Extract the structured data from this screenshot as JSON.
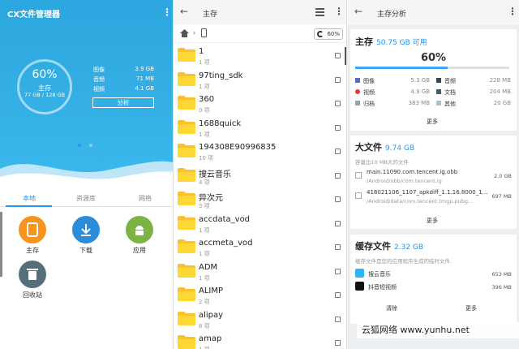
{
  "panel1": {
    "app_title": "CX文件管理器",
    "ring": {
      "percent": "60%",
      "label": "主存",
      "size": "77 GB / 128 GB"
    },
    "stats": [
      {
        "label": "图像",
        "value": "3.9 GB"
      },
      {
        "label": "音频",
        "value": "71 MB"
      },
      {
        "label": "视频",
        "value": "4.1 GB"
      }
    ],
    "analyze_label": "分析",
    "tabs": [
      "本地",
      "资源库",
      "网络"
    ],
    "categories": [
      {
        "label": "主存",
        "color": "#f7941d"
      },
      {
        "label": "下载",
        "color": "#2b8dd8"
      },
      {
        "label": "应用",
        "color": "#7cb342"
      },
      {
        "label": "回收站",
        "color": "#546e7a"
      }
    ]
  },
  "panel2": {
    "title": "主存",
    "storage_pct": "60%",
    "folders": [
      {
        "name": "1",
        "sub": "1 项"
      },
      {
        "name": "97ting_sdk",
        "sub": "1 项"
      },
      {
        "name": "360",
        "sub": "0 项"
      },
      {
        "name": "1688quick",
        "sub": "1 项"
      },
      {
        "name": "194308E90996835",
        "sub": "10 项"
      },
      {
        "name": "搜云音乐",
        "sub": "4 项"
      },
      {
        "name": "异次元",
        "sub": "3 项"
      },
      {
        "name": "accdata_vod",
        "sub": "1 项"
      },
      {
        "name": "accmeta_vod",
        "sub": "1 项"
      },
      {
        "name": "ADM",
        "sub": "1 项"
      },
      {
        "name": "ALIMP",
        "sub": "2 项"
      },
      {
        "name": "alipay",
        "sub": "8 项"
      },
      {
        "name": "amap",
        "sub": "1 项"
      }
    ]
  },
  "panel3": {
    "title": "主存分析",
    "main": {
      "title": "主存",
      "available": "50.75 GB 可用",
      "percent": "60%",
      "fill": 0.6,
      "legend": [
        {
          "label": "图像",
          "value": "5.3 GB",
          "color": "#5c6bc0"
        },
        {
          "label": "音频",
          "value": "228 MB",
          "color": "#37474f"
        },
        {
          "label": "视频",
          "value": "4.9 GB",
          "color": "#e53935"
        },
        {
          "label": "文档",
          "value": "204 MB",
          "color": "#455a64"
        },
        {
          "label": "归档",
          "value": "383 MB",
          "color": "#90a4ae"
        },
        {
          "label": "其他",
          "value": "20 GB",
          "color": "#b0bec5"
        }
      ],
      "more": "更多"
    },
    "large": {
      "title": "大文件",
      "size": "9.74 GB",
      "desc": "容量比10 MB大的文件",
      "files": [
        {
          "name": "main.11090.com.tencent.ig.obb",
          "path": "/Android/obb/com.tencent.ig",
          "size": "2.0 GB"
        },
        {
          "name": "418021106_1107_apkdiff_1.1.16.8000_1...",
          "path": "/Android/data/com.tencent.tmgp.pubg...",
          "size": "697 MB"
        }
      ],
      "more": "更多"
    },
    "cache": {
      "title": "缓存文件",
      "size": "2.32 GB",
      "desc": "缓存文件是您的应用程序生成的临时文件.",
      "apps": [
        {
          "name": "搜云音乐",
          "size": "653 MB"
        },
        {
          "name": "抖音短视频",
          "size": "396 MB"
        }
      ],
      "clear": "清除",
      "more": "更多"
    }
  },
  "watermark": "云狐网络 www.yunhu.net"
}
